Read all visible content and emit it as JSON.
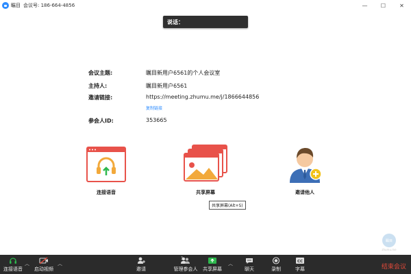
{
  "titlebar": {
    "app_name": "瞩目",
    "meeting_id_label": "会议号: 186-664-4856",
    "minimize": "—",
    "maximize": "☐",
    "close": "✕"
  },
  "speaking_banner": "说话：",
  "meeting_info": {
    "topic_label": "会议主题:",
    "topic_value": "瞩目新用户6561的个人会议室",
    "host_label": "主持人:",
    "host_value": "瞩目新用户6561",
    "invite_label": "邀请链接:",
    "invite_value": "https://meeting.zhumu.me/j/1866644856",
    "copy_link": "复制链接",
    "participant_label": "参会人ID:",
    "participant_value": "353665"
  },
  "actions": {
    "join_audio": "连接语音",
    "share_screen": "共享屏幕",
    "invite_others": "邀请他人"
  },
  "tooltip": "共享屏幕(Alt+S)",
  "toolbar": {
    "join_audio": "连接语音",
    "start_video": "启动视频",
    "invite": "邀请",
    "manage_participants": "管理参会人",
    "participant_count": "1",
    "share_screen": "共享屏幕",
    "chat": "聊天",
    "record": "录制",
    "subtitles": "字幕",
    "end_meeting": "结束会议"
  },
  "watermark": {
    "badge": "瞩目",
    "text": "zhumu.me"
  },
  "colors": {
    "accent": "#2d8cff",
    "action_red": "#e8524a",
    "toolbar_bg": "#2b2b2b",
    "end_meeting": "#e24a3a",
    "share_green": "#2db84d"
  }
}
